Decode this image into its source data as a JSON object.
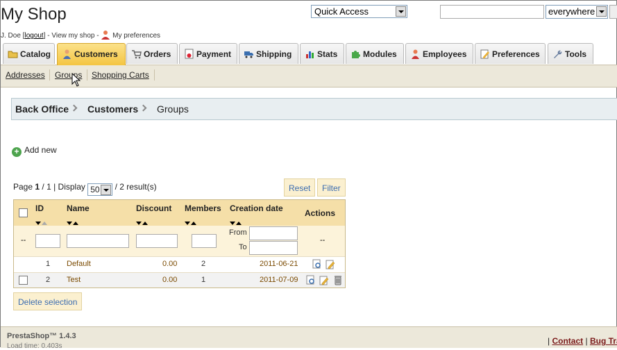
{
  "header": {
    "shop_title": "My Shop",
    "user_prefix": "J. Doe [",
    "logout": "logout",
    "user_mid": "] - View my shop -",
    "my_preferences": "My preferences",
    "quick_access": "Quick Access",
    "search_value": "",
    "search_scope": "everywhere"
  },
  "tabs": [
    {
      "label": "Catalog",
      "icon": "folder-icon"
    },
    {
      "label": "Customers",
      "icon": "customer-icon",
      "active": true
    },
    {
      "label": "Orders",
      "icon": "cart-icon"
    },
    {
      "label": "Payment",
      "icon": "payment-icon"
    },
    {
      "label": "Shipping",
      "icon": "truck-icon"
    },
    {
      "label": "Stats",
      "icon": "chart-icon"
    },
    {
      "label": "Modules",
      "icon": "puzzle-icon"
    },
    {
      "label": "Employees",
      "icon": "employee-icon"
    },
    {
      "label": "Preferences",
      "icon": "preferences-icon"
    },
    {
      "label": "Tools",
      "icon": "wrench-icon"
    }
  ],
  "subtabs": [
    "Addresses",
    "Groups",
    "Shopping Carts"
  ],
  "breadcrumb": [
    "Back Office",
    "Customers",
    "Groups"
  ],
  "add_new": "Add new",
  "pagination": {
    "page_prefix": "Page",
    "current_page": "1",
    "total_pages": "/ 1 | Display",
    "display_value": "50",
    "results": "/ 2 result(s)"
  },
  "buttons": {
    "reset": "Reset",
    "filter": "Filter",
    "delete_selection": "Delete selection"
  },
  "table": {
    "headers": {
      "id": "ID",
      "name": "Name",
      "discount": "Discount",
      "members": "Members",
      "creation_date": "Creation date",
      "actions": "Actions"
    },
    "filter": {
      "dash": "--",
      "from": "From",
      "to": "To",
      "actions_dash": "--"
    },
    "rows": [
      {
        "id": "1",
        "name": "Default",
        "discount": "0.00",
        "members": "2",
        "date": "2011-06-21"
      },
      {
        "id": "2",
        "name": "Test",
        "discount": "0.00",
        "members": "1",
        "date": "2011-07-09"
      }
    ]
  },
  "footer": {
    "version": "PrestaShop™ 1.4.3",
    "load_time": "Load time: 0.403s",
    "separator": "|",
    "contact": "Contact",
    "bug_tracker": "Bug Tracker"
  }
}
